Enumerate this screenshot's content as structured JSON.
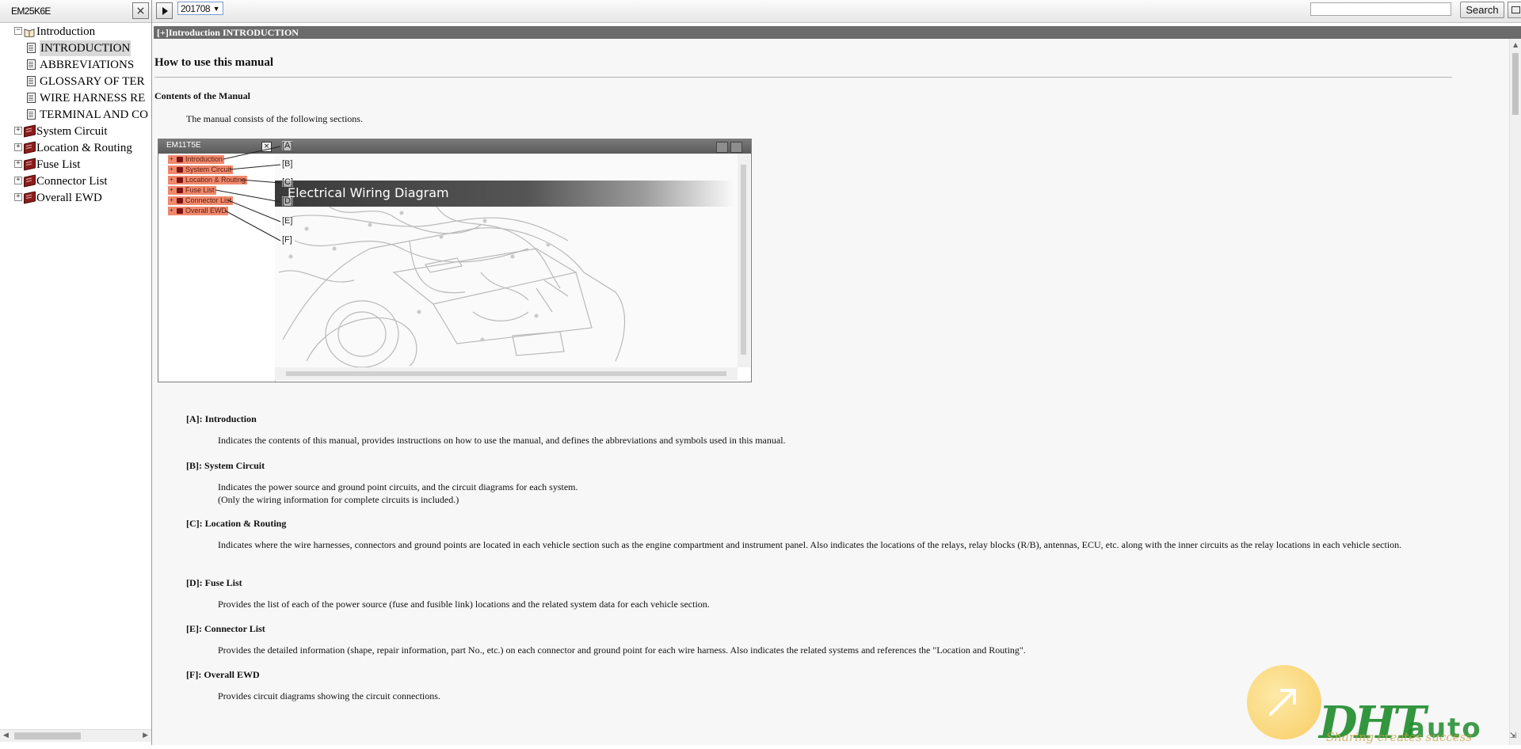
{
  "left_pane": {
    "doc_code": "EM25K6E",
    "close_label": "×",
    "tree": [
      {
        "label": "Introduction",
        "expander": "−",
        "icon": "open-book-icon",
        "level": 0
      },
      {
        "label": "INTRODUCTION",
        "icon": "page-icon",
        "level": 1,
        "selected": true
      },
      {
        "label": "ABBREVIATIONS",
        "icon": "page-icon",
        "level": 1
      },
      {
        "label": "GLOSSARY OF TER",
        "icon": "page-icon",
        "level": 1
      },
      {
        "label": "WIRE HARNESS RE",
        "icon": "page-icon",
        "level": 1
      },
      {
        "label": "TERMINAL AND CO",
        "icon": "page-icon",
        "level": 1
      },
      {
        "label": "System Circuit",
        "expander": "+",
        "icon": "book-icon",
        "level": 0
      },
      {
        "label": "Location & Routing",
        "expander": "+",
        "icon": "book-icon",
        "level": 0
      },
      {
        "label": "Fuse List",
        "expander": "+",
        "icon": "book-icon",
        "level": 0
      },
      {
        "label": "Connector List",
        "expander": "+",
        "icon": "book-icon",
        "level": 0
      },
      {
        "label": "Overall EWD",
        "expander": "+",
        "icon": "book-icon",
        "level": 0
      }
    ]
  },
  "toolbar": {
    "version": "201708",
    "search_placeholder": "",
    "search_label": "Search"
  },
  "content": {
    "section_header": "[+]Introduction  INTRODUCTION",
    "title": "How to use this manual",
    "contents_heading": "Contents of the Manual",
    "intro": "The manual consists of the following sections.",
    "figure": {
      "window_code": "EM11T5E",
      "items": [
        "Introduction",
        "System Circuit",
        "Location & Routing",
        "Fuse List",
        "Connector List",
        "Overall EWD"
      ],
      "callouts": [
        "[A]",
        "[B]",
        "[C]",
        "[D]",
        "[E]",
        "[F]"
      ],
      "banner": "Electrical Wiring Diagram"
    },
    "sections": [
      {
        "head": "[A]: Introduction",
        "body": [
          "Indicates the contents of this manual, provides instructions on how to use the manual, and defines the abbreviations and symbols used in this manual."
        ]
      },
      {
        "head": "[B]: System Circuit",
        "body": [
          "Indicates the power source and ground point circuits, and the circuit diagrams for each system.",
          "(Only the wiring information for complete circuits is included.)"
        ]
      },
      {
        "head": "[C]: Location & Routing",
        "body": [
          "Indicates where the wire harnesses, connectors and ground points are located in each vehicle section such as the engine compartment and instrument panel. Also indicates the locations of the relays, relay blocks (R/B), antennas, ECU, etc. along with the inner circuits as the relay locations in each vehicle section."
        ]
      },
      {
        "head": "[D]: Fuse List",
        "body": [
          "Provides the list of each of the power source (fuse and fusible link) locations and the related system data for each vehicle section."
        ]
      },
      {
        "head": "[E]: Connector List",
        "body": [
          "Provides the detailed information (shape, repair information, part No., etc.) on each connector and ground point for each wire harness. Also indicates the related systems and references the \"Location and Routing\"."
        ]
      },
      {
        "head": "[F]: Overall EWD",
        "body": [
          "Provides circuit diagrams showing the circuit connections."
        ]
      }
    ]
  },
  "watermark": {
    "logo": "DHT",
    "auto": "auto",
    "tagline": "Sharing creates success"
  },
  "colors": {
    "header_bg": "#6b6b6b",
    "figure_item": "#f0886c",
    "book_icon": "#8b1d1d",
    "watermark_green": "#1e8c2c"
  }
}
